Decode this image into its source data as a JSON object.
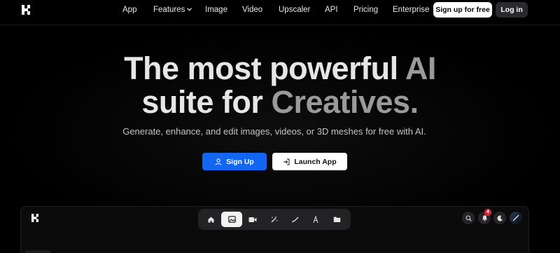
{
  "nav": {
    "links": [
      {
        "label": "App"
      },
      {
        "label": "Features"
      },
      {
        "label": "Image"
      },
      {
        "label": "Video"
      },
      {
        "label": "Upscaler"
      },
      {
        "label": "API"
      },
      {
        "label": "Pricing"
      },
      {
        "label": "Enterprise"
      }
    ],
    "signup_label": "Sign up for free",
    "login_label": "Log in"
  },
  "hero": {
    "line1_a": "The most powerful",
    "line1_b": "AI",
    "line2_a": "suite for",
    "line2_b": "Creatives.",
    "subtitle": "Generate, enhance, and edit images, videos, or 3D meshes for free with AI.",
    "primary_cta": "Sign Up",
    "secondary_cta": "Launch App"
  },
  "preview": {
    "toolbar_items": [
      "home-icon",
      "image-icon",
      "video-icon",
      "magic-wand-icon",
      "brush-icon",
      "text-icon",
      "folder-icon"
    ],
    "active_item": "image-icon",
    "notification_count": "4"
  },
  "colors": {
    "background": "#000000",
    "primary": "#1266f1",
    "badge": "#e0223a"
  }
}
